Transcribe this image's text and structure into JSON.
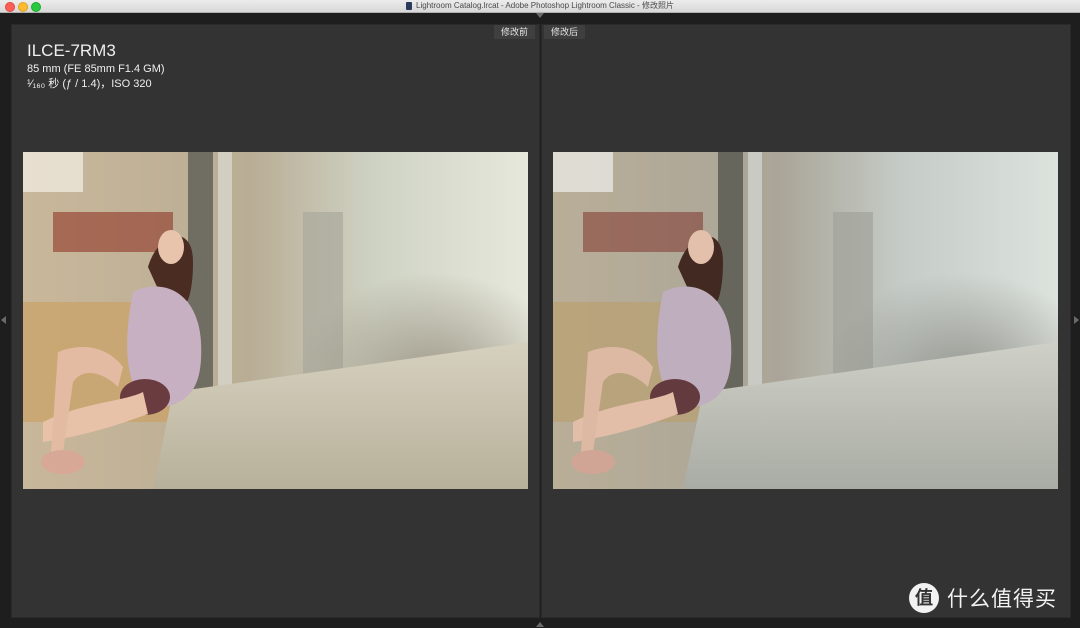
{
  "window": {
    "title": "Lightroom Catalog.lrcat - Adobe Photoshop Lightroom Classic - 修改照片"
  },
  "compare": {
    "before_label": "修改前",
    "after_label": "修改后"
  },
  "info_overlay": {
    "camera_model": "ILCE-7RM3",
    "lens": "85 mm (FE 85mm F1.4 GM)",
    "exposure": "¹⁄₁₆₀ 秒 (ƒ / 1.4)，ISO 320"
  },
  "watermark": {
    "logo_glyph": "值",
    "text": "什么值得买"
  },
  "colors": {
    "panel_background": "#333333",
    "window_background": "#1e1e1e",
    "label_background": "#3f3f3f",
    "text_primary": "#efefef"
  }
}
